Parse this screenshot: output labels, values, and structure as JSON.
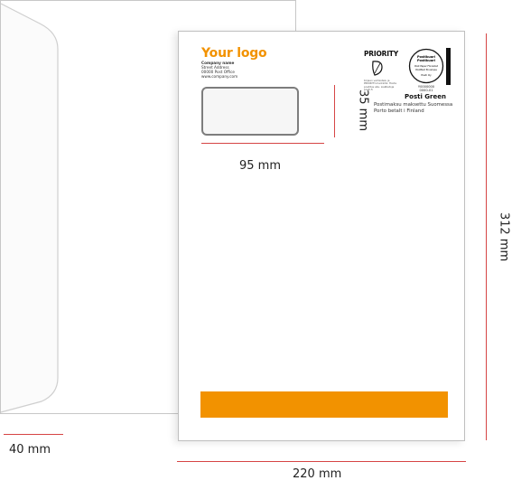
{
  "front": {
    "logo": "Your logo",
    "sender": {
      "company": "Company name",
      "street": "Street Address",
      "postal": "00000 Post Office",
      "web": "www.company.com"
    },
    "priority_label": "PRIORITY",
    "priority_note": "Kirjeen valmistelu ja PRIORITY-merkintä. Hoida postitus alla. Lisätietoja posti.fi",
    "stamp": {
      "ring_line1": "Postikuori",
      "ring_line2": "Postikuori",
      "ring_line3": "Post Paper Förslutet",
      "ring_line4": "PostPaid Envelope",
      "ring_line5": "Posti Oy",
      "code_line1": "Y0000000",
      "code_line2": "0000-01",
      "brand": "Posti Green",
      "postage_fi": "Postimaksu maksettu Suomessa",
      "postage_sv": "Porto betalt i Finland"
    },
    "accent_color": "#f29200"
  },
  "dimensions": {
    "window_width": "95 mm",
    "window_height": "35 mm",
    "envelope_width": "220 mm",
    "envelope_height": "312 mm",
    "flap_depth": "40 mm"
  },
  "dimension_color": "#d64545"
}
